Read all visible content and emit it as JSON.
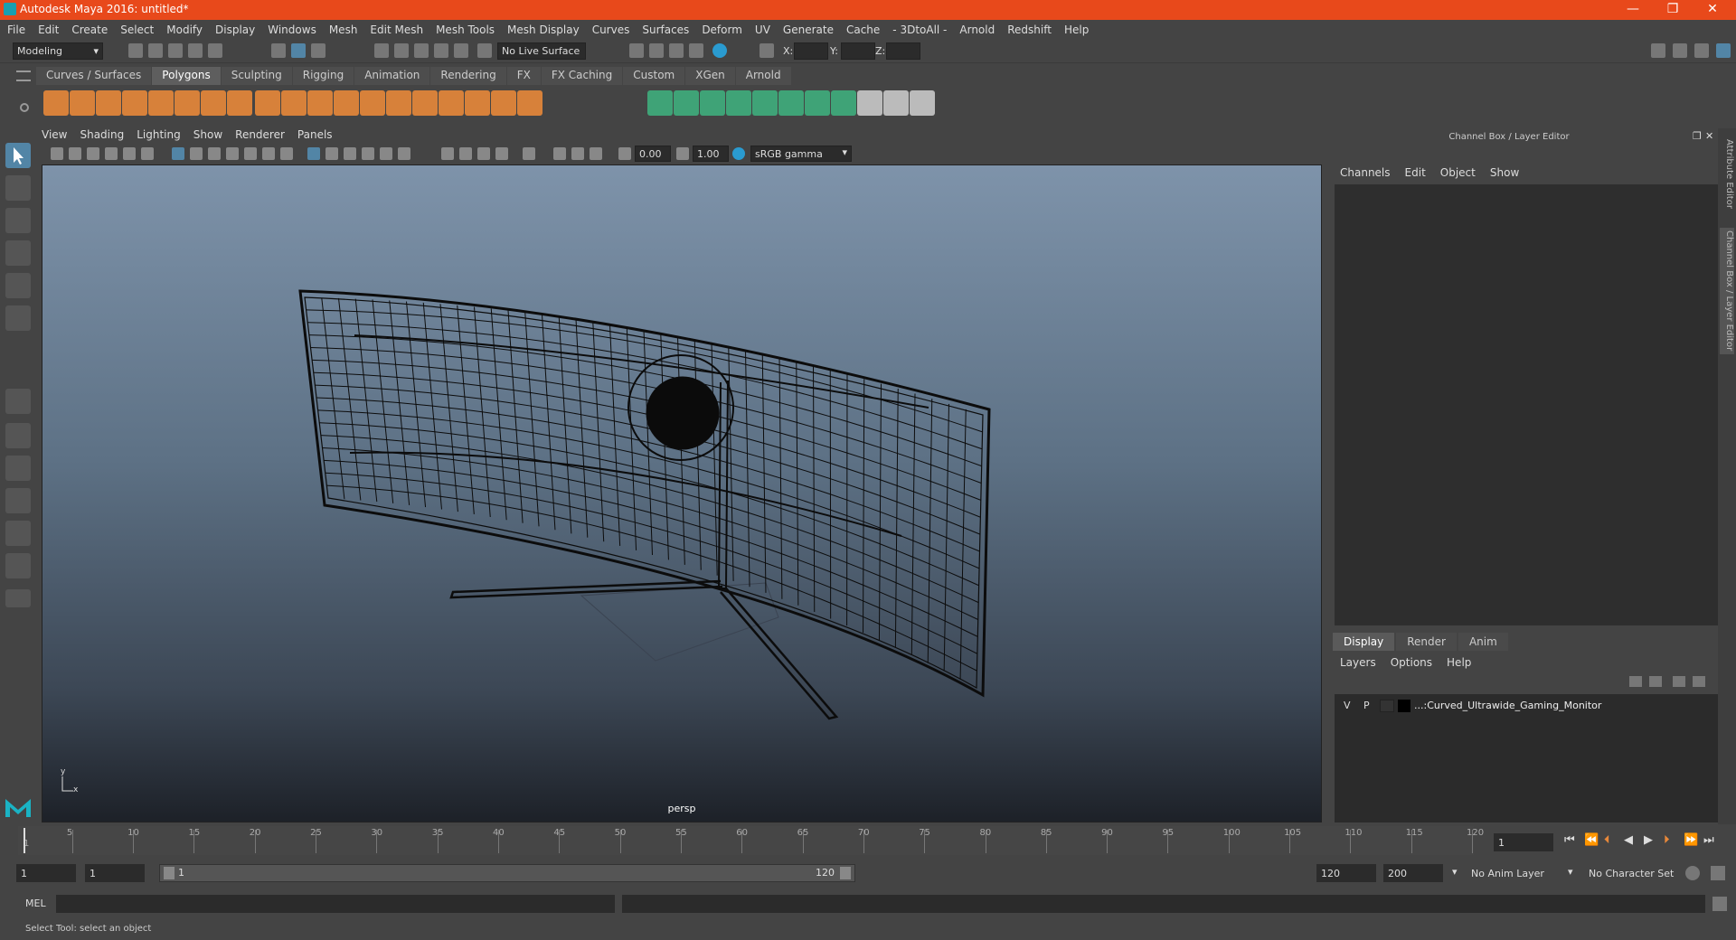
{
  "window": {
    "title": "Autodesk Maya 2016: untitled*",
    "minimize": "—",
    "restore": "❐",
    "close": "✕"
  },
  "menubar": [
    "File",
    "Edit",
    "Create",
    "Select",
    "Modify",
    "Display",
    "Windows",
    "Mesh",
    "Edit Mesh",
    "Mesh Tools",
    "Mesh Display",
    "Curves",
    "Surfaces",
    "Deform",
    "UV",
    "Generate",
    "Cache",
    "- 3DtoAll -",
    "Arnold",
    "Redshift",
    "Help"
  ],
  "status": {
    "menuset": "Modeling",
    "live_surface": "No Live Surface",
    "x_label": "X:",
    "y_label": "Y:",
    "z_label": "Z:"
  },
  "shelf_tabs": [
    "Curves / Surfaces",
    "Polygons",
    "Sculpting",
    "Rigging",
    "Animation",
    "Rendering",
    "FX",
    "FX Caching",
    "Custom",
    "XGen",
    "Arnold"
  ],
  "active_shelf_tab": "Polygons",
  "viewport": {
    "menus": [
      "View",
      "Shading",
      "Lighting",
      "Show",
      "Renderer",
      "Panels"
    ],
    "exposure": "0.00",
    "gamma": "1.00",
    "color_space": "sRGB gamma",
    "camera_label": "persp",
    "axis_y": "y",
    "axis_x": "x"
  },
  "channel_box": {
    "title": "Channel Box / Layer Editor",
    "menus": [
      "Channels",
      "Edit",
      "Object",
      "Show"
    ]
  },
  "layer_editor": {
    "tabs": [
      "Display",
      "Render",
      "Anim"
    ],
    "active_tab": "Display",
    "menus": [
      "Layers",
      "Options",
      "Help"
    ],
    "layers": [
      {
        "visible": "V",
        "playback": "P",
        "name": "...:Curved_Ultrawide_Gaming_Monitor"
      }
    ]
  },
  "side_tabs": [
    "Attribute Editor",
    "Channel Box / Layer Editor"
  ],
  "timeline": {
    "ticks": [
      "5",
      "10",
      "15",
      "20",
      "25",
      "30",
      "35",
      "40",
      "45",
      "50",
      "55",
      "60",
      "65",
      "70",
      "75",
      "80",
      "85",
      "90",
      "95",
      "100",
      "105",
      "110",
      "115",
      "120"
    ],
    "start_frame_marker": "1",
    "current_frame": "1"
  },
  "range": {
    "start": "1",
    "playback_start": "1",
    "slider_start": "1",
    "slider_end": "120",
    "playback_end": "120",
    "end": "200",
    "anim_layer": "No Anim Layer",
    "character_set": "No Character Set"
  },
  "command_line": {
    "label": "MEL"
  },
  "help_line": "Select Tool: select an object",
  "colors": {
    "titlebar": "#e8491b",
    "accent": "#5285a6",
    "shelf_orange": "#e8883a",
    "shelf_green": "#3fae7d"
  }
}
